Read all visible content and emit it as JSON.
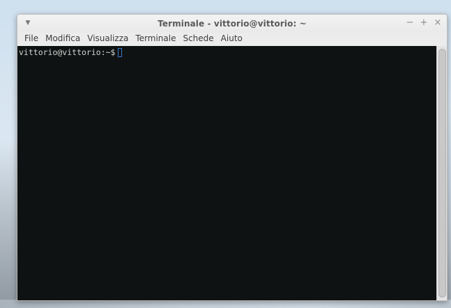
{
  "window": {
    "title": "Terminale - vittorio@vittorio: ~",
    "menu_icon": "chevron-down-icon",
    "controls": {
      "minimize": "−",
      "maximize": "+",
      "close": "×"
    }
  },
  "menubar": {
    "items": [
      "File",
      "Modifica",
      "Visualizza",
      "Terminale",
      "Schede",
      "Aiuto"
    ]
  },
  "terminal": {
    "prompt": "vittorio@vittorio:~$",
    "background": "#0f1212",
    "cursor_color": "#3a78c8"
  }
}
